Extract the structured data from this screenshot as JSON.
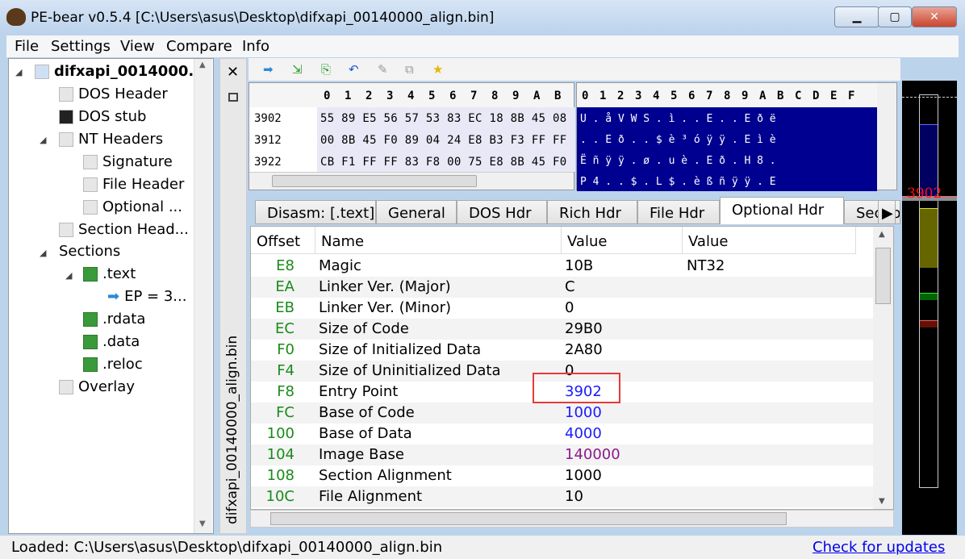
{
  "window": {
    "title": "PE-bear v0.5.4 [C:\\Users\\asus\\Desktop\\difxapi_00140000_align.bin]",
    "minimize": "▁",
    "maximize": "▢",
    "close": "✕"
  },
  "menu": [
    "File",
    "Settings",
    "View",
    "Compare",
    "Info"
  ],
  "tree": {
    "root": "difxapi_0014000...",
    "items": [
      "DOS Header",
      "DOS stub",
      "NT Headers",
      "Signature",
      "File Header",
      "Optional ...",
      "Section Head...",
      "Sections",
      ".text",
      "EP = 3...",
      ".rdata",
      ".data",
      ".reloc",
      "Overlay"
    ]
  },
  "dock": {
    "title": "difxapi_00140000_align.bin",
    "close": "✕"
  },
  "hex": {
    "columns": [
      "0",
      "1",
      "2",
      "3",
      "4",
      "5",
      "6",
      "7",
      "8",
      "9",
      "A",
      "B"
    ],
    "ascii_columns": [
      "0",
      "1",
      "2",
      "3",
      "4",
      "5",
      "6",
      "7",
      "8",
      "9",
      "A",
      "B",
      "C",
      "D",
      "E",
      "F"
    ],
    "rows": [
      {
        "addr": "3902",
        "bytes": "55 89 E5 56 57 53 83 EC 18 8B 45 08"
      },
      {
        "addr": "3912",
        "bytes": "00 8B 45 F0 89 04 24 E8 B3 F3 FF FF"
      },
      {
        "addr": "3922",
        "bytes": "CB F1 FF FF 83 F8 00 75 E8 8B 45 F0"
      }
    ],
    "ascii": [
      "U . å V W S . ì . . E . . E ð ë",
      ". . E ð . . $ è ³ ó ÿ ÿ . E ì è",
      "Ë ñ ÿ ÿ . ø . u è . E ð . H 8 .",
      "P 4 . . $ . L $ . è ß ñ ÿ ÿ . E"
    ]
  },
  "tabs": [
    "Disasm: [.text]",
    "General",
    "DOS Hdr",
    "Rich Hdr",
    "File Hdr",
    "Optional Hdr",
    "Section"
  ],
  "active_tab": "Optional Hdr",
  "table": {
    "headers": [
      "Offset",
      "Name",
      "Value",
      "Value"
    ],
    "rows": [
      {
        "offset": "E8",
        "name": "Magic",
        "value": "10B",
        "value2": "NT32",
        "color": "#000000"
      },
      {
        "offset": "EA",
        "name": "Linker Ver. (Major)",
        "value": "C",
        "value2": "",
        "color": "#000000"
      },
      {
        "offset": "EB",
        "name": "Linker Ver. (Minor)",
        "value": "0",
        "value2": "",
        "color": "#000000"
      },
      {
        "offset": "EC",
        "name": "Size of Code",
        "value": "29B0",
        "value2": "",
        "color": "#000000"
      },
      {
        "offset": "F0",
        "name": "Size of Initialized Data",
        "value": "2A80",
        "value2": "",
        "color": "#000000"
      },
      {
        "offset": "F4",
        "name": "Size of Uninitialized Data",
        "value": "0",
        "value2": "",
        "color": "#000000"
      },
      {
        "offset": "F8",
        "name": "Entry Point",
        "value": "3902",
        "value2": "",
        "color": "#1a1aff"
      },
      {
        "offset": "FC",
        "name": "Base of Code",
        "value": "1000",
        "value2": "",
        "color": "#1a1aff"
      },
      {
        "offset": "100",
        "name": "Base of Data",
        "value": "4000",
        "value2": "",
        "color": "#1a1aff"
      },
      {
        "offset": "104",
        "name": "Image Base",
        "value": "140000",
        "value2": "",
        "color": "#8b1a8b"
      },
      {
        "offset": "108",
        "name": "Section Alignment",
        "value": "1000",
        "value2": "",
        "color": "#000000"
      },
      {
        "offset": "10C",
        "name": "File Alignment",
        "value": "10",
        "value2": "",
        "color": "#000000"
      }
    ]
  },
  "strip": {
    "marker": "3902"
  },
  "status": {
    "loaded": "Loaded: C:\\Users\\asus\\Desktop\\difxapi_00140000_align.bin",
    "update_link": "Check for updates"
  }
}
